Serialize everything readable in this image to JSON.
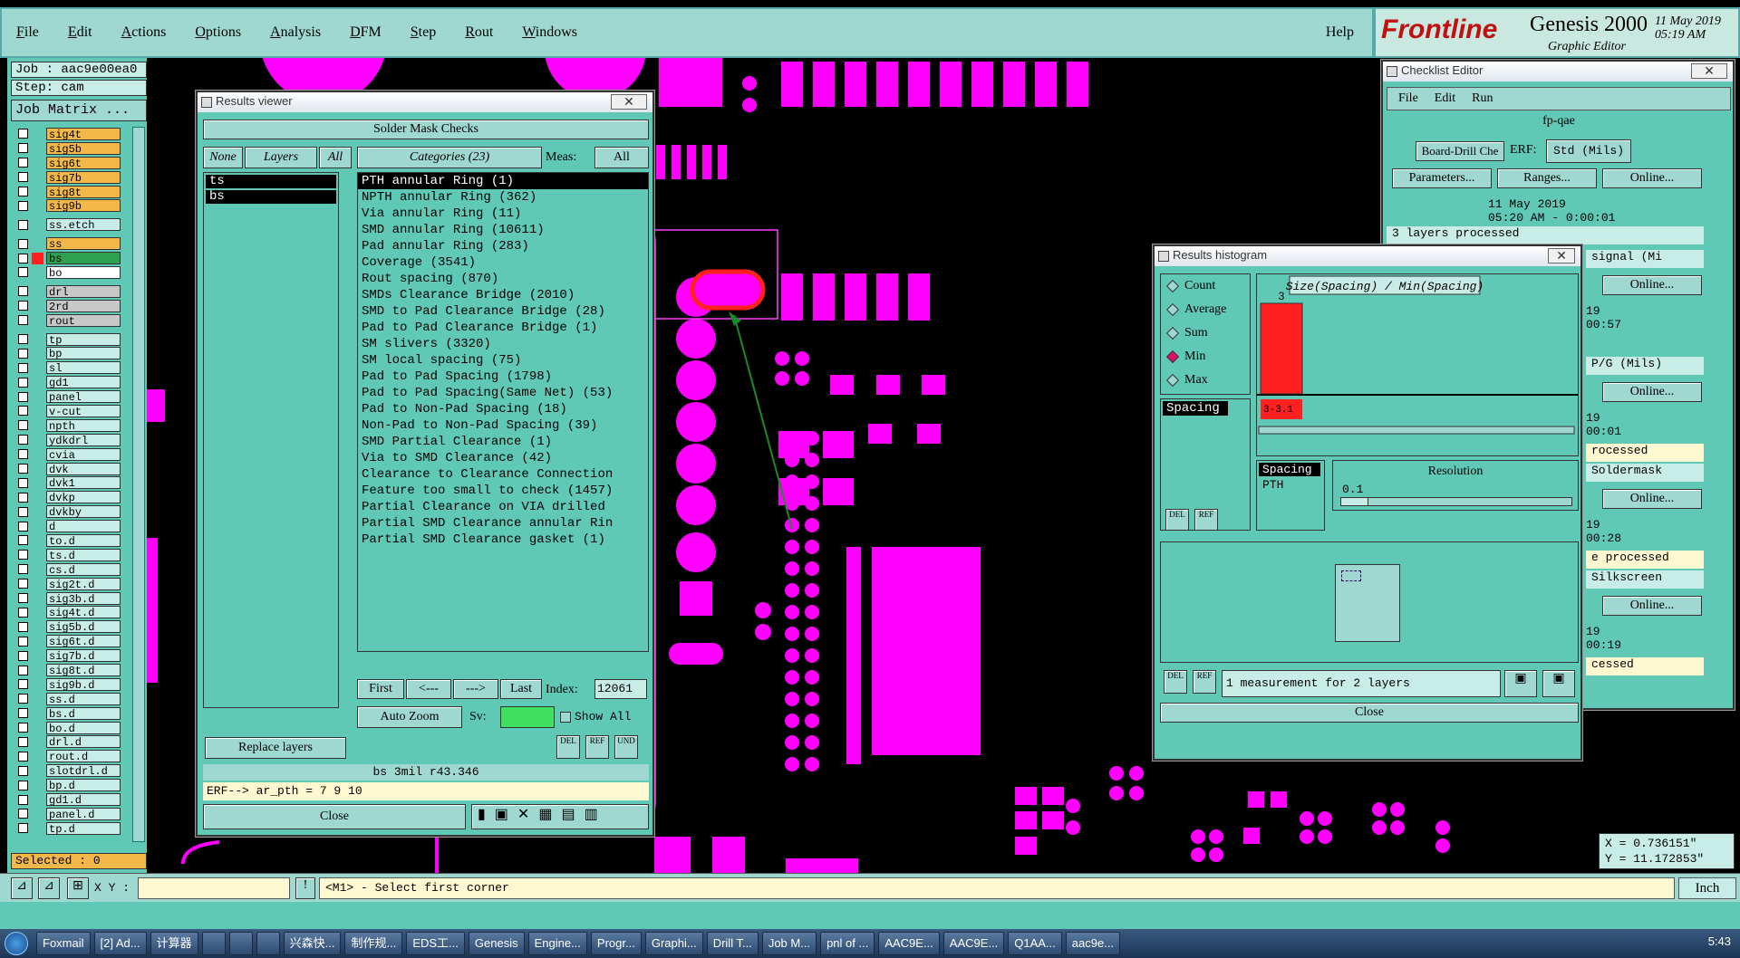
{
  "menubar": {
    "items": [
      "File",
      "Edit",
      "Actions",
      "Options",
      "Analysis",
      "DFM",
      "Step",
      "Rout",
      "Windows"
    ],
    "help": "Help"
  },
  "brand": {
    "logo": "Frontline",
    "product": "Genesis 2000",
    "subtitle": "Graphic Editor",
    "date": "11 May 2019",
    "time": "05:19 AM"
  },
  "job": {
    "job": "Job : aac9e00ea0",
    "step": "Step: cam",
    "matrix": "Job Matrix ..."
  },
  "layers": [
    {
      "name": "sig4t",
      "type": "sig"
    },
    {
      "name": "sig5b",
      "type": "sig"
    },
    {
      "name": "sig6t",
      "type": "sig"
    },
    {
      "name": "sig7b",
      "type": "sig"
    },
    {
      "name": "sig8t",
      "type": "sig"
    },
    {
      "name": "sig9b",
      "type": "sig"
    },
    {
      "name": "",
      "type": "gap"
    },
    {
      "name": "ss.etch",
      "type": "plain"
    },
    {
      "name": "",
      "type": "gap"
    },
    {
      "name": "ss",
      "type": "sig"
    },
    {
      "name": "bs",
      "type": "bs"
    },
    {
      "name": "bo",
      "type": "bo"
    },
    {
      "name": "",
      "type": "gap"
    },
    {
      "name": "drl",
      "type": "drl"
    },
    {
      "name": "2rd",
      "type": "drl"
    },
    {
      "name": "rout",
      "type": "drl"
    },
    {
      "name": "",
      "type": "gap"
    },
    {
      "name": "tp",
      "type": "plain"
    },
    {
      "name": "bp",
      "type": "plain"
    },
    {
      "name": "sl",
      "type": "plain"
    },
    {
      "name": "gd1",
      "type": "plain"
    },
    {
      "name": "panel",
      "type": "plain"
    },
    {
      "name": "v-cut",
      "type": "plain"
    },
    {
      "name": "npth",
      "type": "plain"
    },
    {
      "name": "ydkdrl",
      "type": "plain"
    },
    {
      "name": "cvia",
      "type": "plain"
    },
    {
      "name": "dvk",
      "type": "plain"
    },
    {
      "name": "dvk1",
      "type": "plain"
    },
    {
      "name": "dvkp",
      "type": "plain"
    },
    {
      "name": "dvkby",
      "type": "plain"
    },
    {
      "name": "d",
      "type": "plain"
    },
    {
      "name": "to.d",
      "type": "plain"
    },
    {
      "name": "ts.d",
      "type": "plain"
    },
    {
      "name": "cs.d",
      "type": "plain"
    },
    {
      "name": "sig2t.d",
      "type": "plain"
    },
    {
      "name": "sig3b.d",
      "type": "plain"
    },
    {
      "name": "sig4t.d",
      "type": "plain"
    },
    {
      "name": "sig5b.d",
      "type": "plain"
    },
    {
      "name": "sig6t.d",
      "type": "plain"
    },
    {
      "name": "sig7b.d",
      "type": "plain"
    },
    {
      "name": "sig8t.d",
      "type": "plain"
    },
    {
      "name": "sig9b.d",
      "type": "plain"
    },
    {
      "name": "ss.d",
      "type": "plain"
    },
    {
      "name": "bs.d",
      "type": "plain"
    },
    {
      "name": "bo.d",
      "type": "plain"
    },
    {
      "name": "drl.d",
      "type": "plain"
    },
    {
      "name": "rout.d",
      "type": "plain"
    },
    {
      "name": "slotdrl.d",
      "type": "plain"
    },
    {
      "name": "bp.d",
      "type": "plain"
    },
    {
      "name": "gd1.d",
      "type": "plain"
    },
    {
      "name": "panel.d",
      "type": "plain"
    },
    {
      "name": "tp.d",
      "type": "plain"
    }
  ],
  "selected": "Selected : 0",
  "results_viewer": {
    "title": "Results viewer",
    "header": "Solder Mask Checks",
    "none": "None",
    "layers_btn": "Layers",
    "all": "All",
    "categories_btn": "Categories (23)",
    "meas_label": "Meas:",
    "meas_value": "All",
    "layer_items": [
      "ts",
      "bs"
    ],
    "categories": [
      "PTH annular Ring (1)",
      "NPTH annular Ring (362)",
      "Via annular Ring (11)",
      "SMD annular Ring (10611)",
      "Pad annular Ring (283)",
      "Coverage (3541)",
      "Rout spacing (870)",
      "SMDs Clearance Bridge (2010)",
      "SMD to Pad Clearance Bridge (28)",
      "Pad to Pad Clearance Bridge (1)",
      "SM slivers (3320)",
      "SM local spacing (75)",
      "Pad to Pad Spacing (1798)",
      "Pad to Pad Spacing(Same Net) (53)",
      "Pad to Non-Pad Spacing (18)",
      "Non-Pad to Non-Pad Spacing (39)",
      "SMD Partial Clearance (1)",
      "Via to SMD Clearance (42)",
      "Clearance to Clearance Connection",
      "Feature too small to check (1457)",
      "Partial Clearance on VIA drilled",
      "Partial SMD Clearance annular Rin",
      "Partial SMD Clearance gasket (1)"
    ],
    "first": "First",
    "prev": "<---",
    "next": "--->",
    "last": "Last",
    "index_label": "Index:",
    "index_value": "12061",
    "autozoom": "Auto Zoom",
    "sv": "Sv:",
    "showall": "Show All",
    "replace": "Replace layers",
    "info": "bs 3mil  r43.346",
    "erf": "ERF--> ar_pth = 7 9 10",
    "close": "Close"
  },
  "histogram": {
    "title": "Results histogram",
    "options": [
      "Count",
      "Average",
      "Sum",
      "Min",
      "Max"
    ],
    "selected_option": "Min",
    "list_item": "Spacing",
    "chart_title": "Size(Spacing) / Min(Spacing)",
    "resolution_label": "Resolution",
    "resolution_value": "0.1",
    "list2": [
      "Spacing",
      "PTH"
    ],
    "status": "1 measurement for 2 layers",
    "close": "Close",
    "chart_data": {
      "type": "bar",
      "categories": [
        "3-3.1"
      ],
      "values": [
        3
      ],
      "data_labels": [
        "3"
      ],
      "bar_color": "#ff2020"
    }
  },
  "checklist": {
    "title": "Checklist Editor",
    "menu": [
      "File",
      "Edit",
      "Run"
    ],
    "name": "fp-qae",
    "item1": "Board-Drill Che",
    "erf": "ERF:",
    "erf_value": "Std (Mils)",
    "params": "Parameters...",
    "ranges": "Ranges...",
    "online": "Online...",
    "time1": "11 May 2019",
    "time2": "05:20 AM - 0:00:01",
    "processed": "3 layers processed",
    "row2": "signal (Mi",
    "r2a": "19",
    "r2b": "00:57",
    "row3": "P/G (Mils)",
    "r3a": "19",
    "r3b": "00:01",
    "r3c": "rocessed",
    "row4": "Soldermask",
    "r4a": "19",
    "r4b": "00:28",
    "r4c": "e processed",
    "row5": "Silkscreen",
    "r5a": "19",
    "r5b": "00:19",
    "r5c": "cessed"
  },
  "cmdbar": {
    "xy": "X Y :",
    "prompt": "<M1> - Select first corner",
    "units": "Inch"
  },
  "coords": {
    "x": "X = 0.736151\"",
    "y": "Y = 11.172853\""
  },
  "taskbar": {
    "items": [
      "Foxmail",
      "[2] Ad...",
      "计算器",
      "",
      "",
      "",
      "兴森快...",
      "制作规...",
      "EDS工...",
      "Genesis",
      "Engine...",
      "Progr...",
      "Graphi...",
      "Drill T...",
      "Job M...",
      "pnl of ...",
      "AAC9E...",
      "AAC9E...",
      "Q1AA...",
      "aac9e..."
    ],
    "clock": "5:43"
  }
}
